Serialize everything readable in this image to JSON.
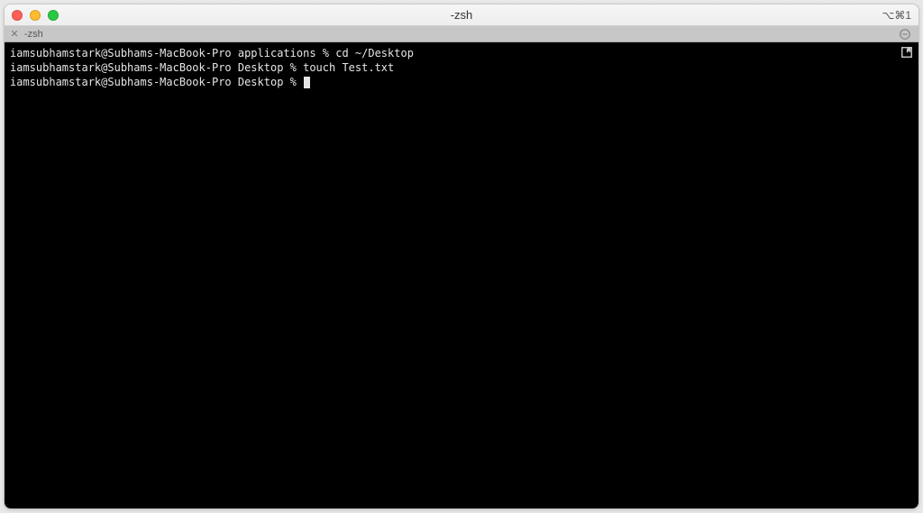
{
  "window": {
    "title": "-zsh",
    "shortcut": "⌥⌘1"
  },
  "tab": {
    "label": "-zsh"
  },
  "terminal": {
    "lines": [
      {
        "prompt": "iamsubhamstark@Subhams-MacBook-Pro applications % ",
        "command": "cd ~/Desktop"
      },
      {
        "prompt": "iamsubhamstark@Subhams-MacBook-Pro Desktop % ",
        "command": "touch Test.txt"
      },
      {
        "prompt": "iamsubhamstark@Subhams-MacBook-Pro Desktop % ",
        "command": ""
      }
    ]
  }
}
